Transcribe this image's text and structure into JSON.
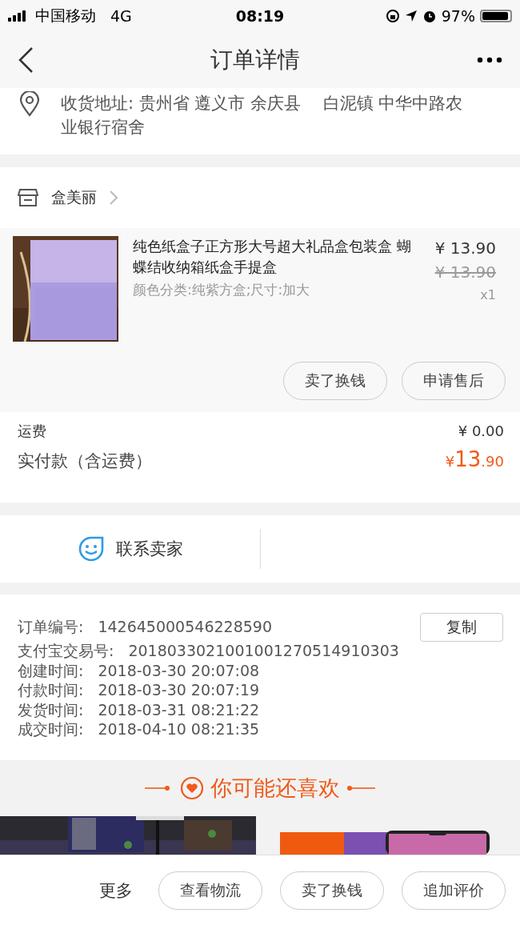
{
  "status_bar": {
    "carrier": "中国移动",
    "network": "4G",
    "time": "08:19",
    "battery": "97%"
  },
  "nav": {
    "title": "订单详情"
  },
  "address": {
    "text": "收货地址: 贵州省 遵义市 余庆县　 白泥镇 中华中路农业银行宿舍"
  },
  "shop": {
    "name": "盒美丽"
  },
  "product": {
    "title": "纯色纸盒子正方形大号超大礼品盒包装盒 蝴蝶结收纳箱纸盒手提盒",
    "sku": "颜色分类:纯紫方盒;尺寸:加大",
    "price": "¥ 13.90",
    "original_price": "¥ 13.90",
    "quantity": "x1",
    "picture": {
      "kind": "picture"
    },
    "actions": [
      "卖了换钱",
      "申请售后"
    ]
  },
  "fees": [
    {
      "label": "运费",
      "value": "¥ 0.00",
      "kind": "plain"
    },
    {
      "label": "实付款（含运费）",
      "currency": "¥",
      "value": "13",
      "decimal": ".90",
      "kind": "total"
    }
  ],
  "contact": {
    "label": "联系卖家"
  },
  "order_info": {
    "copy_button": "复制",
    "rows": [
      {
        "label": "订单编号:",
        "value": "142645000546228590"
      },
      {
        "label": "支付宝交易号:",
        "value": "2018033021001001270514910303"
      },
      {
        "label": "创建时间:",
        "value": "2018-03-30 20:07:08"
      },
      {
        "label": "付款时间:",
        "value": "2018-03-30 20:07:19"
      },
      {
        "label": "发货时间:",
        "value": "2018-03-31 08:21:22"
      },
      {
        "label": "成交时间:",
        "value": "2018-04-10 08:21:35"
      }
    ]
  },
  "recommend": {
    "title": "你可能还喜欢",
    "items": [
      {
        "kind": "picture"
      },
      {
        "kind": "picture"
      }
    ]
  },
  "bottom_bar": {
    "more": "更多",
    "buttons": [
      "查看物流",
      "卖了换钱",
      "追加评价"
    ]
  }
}
